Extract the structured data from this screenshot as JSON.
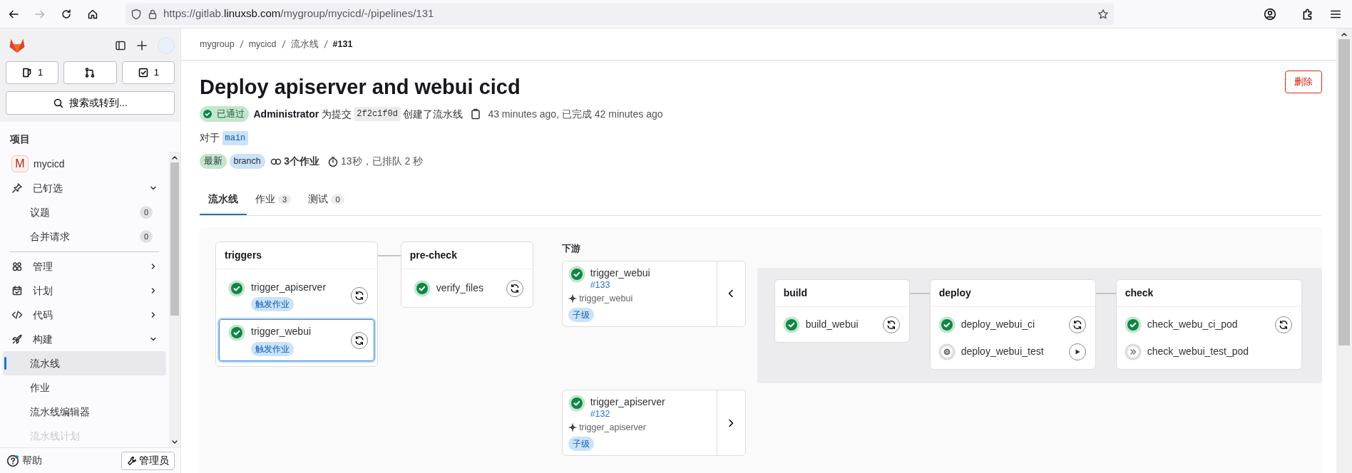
{
  "browser": {
    "url": "https://gitlab.**linuxsb.com**/mygroup/mycicd/-/pipelines/131",
    "forward_disabled": true
  },
  "sidebar": {
    "counters": [
      {
        "kind": "issues",
        "count": "1"
      },
      {
        "kind": "merge_requests"
      },
      {
        "kind": "todos",
        "count": "1"
      }
    ],
    "search": {
      "placeholder": "搜索或转到..."
    },
    "section_title": "项目",
    "project": {
      "initial": "M",
      "name": "mycicd"
    },
    "items": [
      {
        "kind": "pin",
        "label": "已钉选",
        "expanded": true,
        "children": [
          {
            "label": "议题",
            "count": "0",
            "selected": false
          },
          {
            "label": "合并请求",
            "count": "0",
            "selected": false
          }
        ]
      },
      {
        "kind": "users",
        "label": "管理",
        "expanded": false
      },
      {
        "kind": "calendar",
        "label": "计划",
        "expanded": false
      },
      {
        "kind": "code",
        "label": "代码",
        "expanded": false
      },
      {
        "kind": "rocket",
        "label": "构建",
        "expanded": true,
        "children": [
          {
            "label": "流水线",
            "selected": true
          },
          {
            "label": "作业",
            "selected": false
          },
          {
            "label": "流水线编辑器",
            "selected": false
          },
          {
            "label": "流水线计划",
            "selected": false,
            "faded": true
          }
        ]
      }
    ],
    "help": "帮助",
    "admin": "管理员"
  },
  "breadcrumbs": [
    "mygroup",
    "mycicd",
    "流水线",
    "#131"
  ],
  "title": "Deploy apiserver and webui cicd",
  "delete_button": "删除",
  "status": {
    "badge": "已通过",
    "author": "Administrator",
    "text_before": "为提交",
    "commit": "2f2c1f0d",
    "text_after": "创建了流水线",
    "times": "43 minutes ago, 已完成 42 minutes ago"
  },
  "ref": {
    "label": "对于",
    "branch": "main"
  },
  "tags": [
    {
      "label": "最新",
      "color": "#c3e6cd"
    },
    {
      "label": "branch",
      "color": "#cbe2f9"
    }
  ],
  "jobs_count": "3个作业",
  "duration": "13秒，已排队 2 秒",
  "tabs": [
    {
      "label": "流水线",
      "selected": true
    },
    {
      "label": "作业",
      "count": "3",
      "selected": false
    },
    {
      "label": "测试",
      "count": "0",
      "selected": false
    }
  ],
  "graph": {
    "stages": [
      {
        "name": "triggers",
        "jobs": [
          {
            "name": "trigger_apiserver",
            "kind": "success",
            "tag": "触发作业",
            "focused": false
          },
          {
            "name": "trigger_webui",
            "kind": "success",
            "tag": "触发作业",
            "focused": true
          }
        ]
      },
      {
        "name": "pre-check",
        "jobs": [
          {
            "name": "verify_files",
            "kind": "success",
            "focused": false
          }
        ]
      }
    ],
    "downstream": {
      "title": "下游",
      "pipelines": [
        {
          "name": "trigger_webui",
          "id": "#133",
          "source": "trigger_webui",
          "tag": "子级",
          "kind": "success",
          "expanded": true
        },
        {
          "name": "trigger_apiserver",
          "id": "#132",
          "source": "trigger_apiserver",
          "tag": "子级",
          "kind": "success",
          "expanded": false
        }
      ]
    },
    "child_stages": [
      {
        "name": "build",
        "jobs": [
          {
            "name": "build_webui",
            "kind": "success"
          }
        ]
      },
      {
        "name": "deploy",
        "jobs": [
          {
            "name": "deploy_webui_ci",
            "kind": "success"
          },
          {
            "name": "deploy_webui_test",
            "kind": "manual"
          }
        ]
      },
      {
        "name": "check",
        "jobs": [
          {
            "name": "check_webu_ci_pod",
            "kind": "success"
          },
          {
            "name": "check_webui_test_pod",
            "kind": "skipped"
          }
        ]
      }
    ]
  }
}
